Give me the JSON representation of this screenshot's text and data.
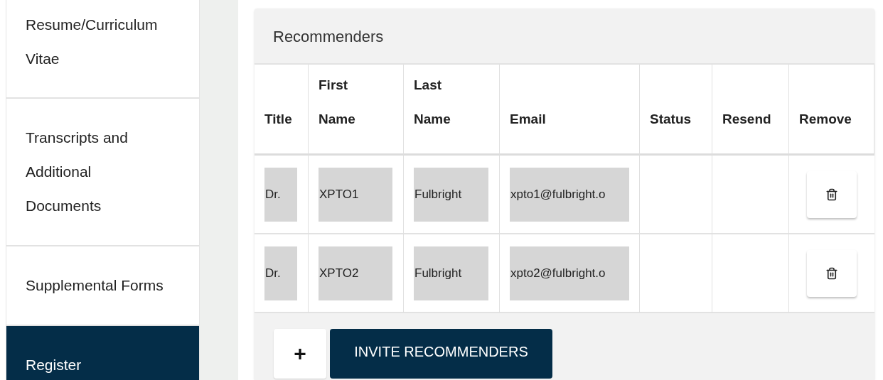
{
  "sidebar": {
    "items": [
      {
        "label": "Resume/Curriculum Vitae",
        "selected": false
      },
      {
        "label": "Transcripts and Additional Documents",
        "selected": false
      },
      {
        "label": "Supplemental Forms",
        "selected": false
      },
      {
        "label": "Register",
        "selected": true
      }
    ]
  },
  "panel": {
    "title": "Recommenders",
    "table": {
      "columns": [
        "Title",
        "First Name",
        "Last Name",
        "Email",
        "Status",
        "Resend",
        "Remove"
      ],
      "rows": [
        {
          "title": "Dr.",
          "first_name": "XPTO1",
          "last_name": "Fulbright",
          "email": "xpto1@fulbright.o"
        },
        {
          "title": "Dr.",
          "first_name": "XPTO2",
          "last_name": "Fulbright",
          "email": "xpto2@fulbright.o"
        }
      ]
    },
    "add_button": "+",
    "invite_button": "INVITE RECOMMENDERS"
  }
}
